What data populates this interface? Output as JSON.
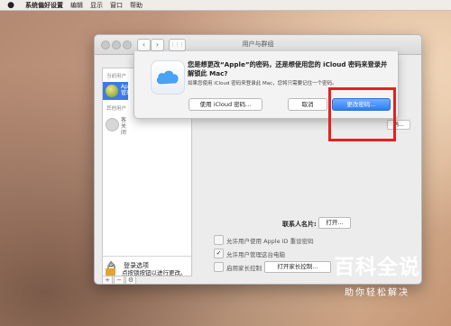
{
  "menubar": {
    "apple_icon": "apple-logo-icon",
    "items": [
      "系统偏好设置",
      "编辑",
      "显示",
      "窗口",
      "帮助"
    ]
  },
  "window": {
    "title": "用户与群组",
    "nav_back": "‹",
    "nav_forward": "›",
    "grid_icon": "⋮⋮⋮"
  },
  "sidebar": {
    "current_users_label": "当前用户",
    "current_user_name": "Appl",
    "current_user_role": "管理",
    "other_users_label": "其他用户",
    "guest_name": "客",
    "guest_status": "关闭",
    "login_options": "登录选项",
    "tools": [
      "+",
      "−",
      "⚙"
    ]
  },
  "panel": {
    "change_password_bg": "码...",
    "contact_card_label": "联系人名片:",
    "contact_card_button": "打开...",
    "option_reset_apple_id": "允许用户使用 Apple ID 重设密码",
    "option_admin": "允许用户管理这台电脑",
    "option_parental": "启用家长控制",
    "open_parental_button": "打开家长控制...",
    "admin_checked": "✓"
  },
  "lock": {
    "text": "点按锁按钮以进行更改。"
  },
  "sheet": {
    "question": "您是想更改“Apple”的密码，还是想使用您的 iCloud 密码来登录并解锁此 Mac?",
    "description": "如果您使用 iCloud 密码来登录此 Mac，您将只需要记住一个密码。",
    "btn_use_icloud": "使用 iCloud 密码...",
    "btn_cancel": "取消",
    "btn_change": "更改密码..."
  },
  "watermark": {
    "title": "百科全说",
    "subtitle": "助你轻松解决"
  },
  "colors": {
    "accent": "#2f7ef3",
    "highlight_box": "#e62020",
    "selected_row": "#3d7be3"
  }
}
